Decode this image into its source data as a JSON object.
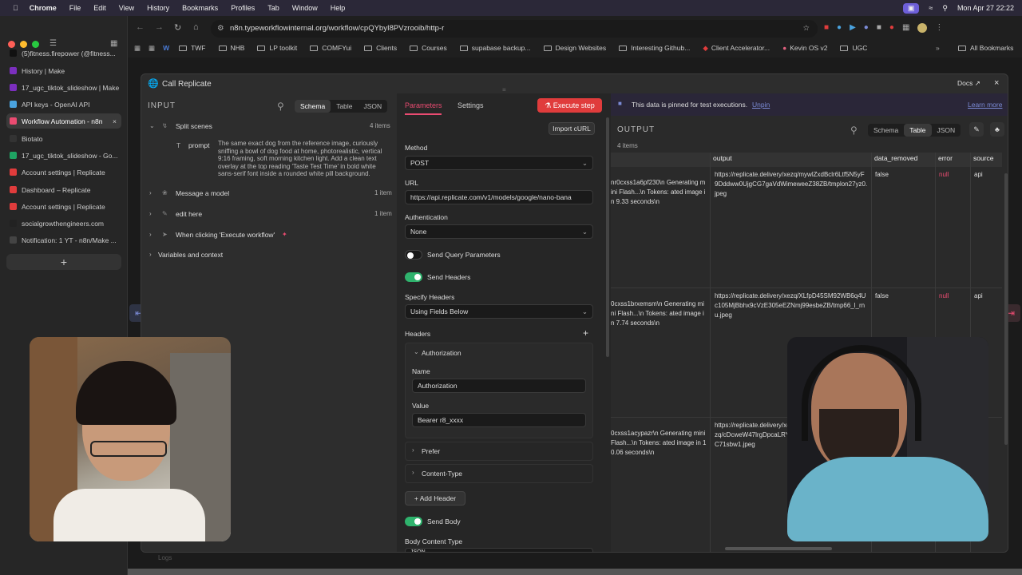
{
  "menubar": {
    "app": "Chrome",
    "items": [
      "File",
      "Edit",
      "View",
      "History",
      "Bookmarks",
      "Profiles",
      "Tab",
      "Window",
      "Help"
    ],
    "clock": "Mon Apr 27  22:22"
  },
  "sidebar": {
    "tabs": [
      {
        "label": "(5)fitness.firepower (@fitness...",
        "color": "#111"
      },
      {
        "label": "History | Make",
        "color": "#7b2fbe"
      },
      {
        "label": "17_ugc_tiktok_slideshow | Make",
        "color": "#7b2fbe"
      },
      {
        "label": "API keys - OpenAI API",
        "color": "#4aa3df"
      },
      {
        "label": "Workflow Automation - n8n",
        "color": "#ea4b71"
      },
      {
        "label": "Biotato",
        "color": "#333"
      },
      {
        "label": "17_ugc_tiktok_slideshow - Go...",
        "color": "#1fa463"
      },
      {
        "label": "Account settings | Replicate",
        "color": "#e03c3c"
      },
      {
        "label": "Dashboard – Replicate",
        "color": "#e03c3c"
      },
      {
        "label": "Account settings | Replicate",
        "color": "#e03c3c"
      },
      {
        "label": "socialgrowthengineers.com",
        "color": "#222"
      },
      {
        "label": "Notification: 1 YT - n8n/Make ...",
        "color": "#444"
      }
    ],
    "new_tab": "+"
  },
  "address": {
    "url": "n8n.typeworkflowinternal.org/workflow/cpQYbyI8PVzrooib/http-r"
  },
  "bookmarks": [
    "TWF",
    "NHB",
    "LP toolkit",
    "COMFYui",
    "Clients",
    "Courses",
    "supabase backup...",
    "Design Websites",
    "Interesting Github...",
    "Client Accelerator...",
    "Kevin OS v2",
    "UGC"
  ],
  "bookmarks_all": "All Bookmarks",
  "modal": {
    "title": "Call Replicate",
    "docs": "Docs",
    "close": "×"
  },
  "input": {
    "heading": "INPUT",
    "tabs": [
      "Schema",
      "Table",
      "JSON"
    ],
    "tree": [
      {
        "label": "Split scenes",
        "count": "4 items"
      },
      {
        "label": "Message a model",
        "count": "1 item"
      },
      {
        "label": "edit here",
        "count": "1 item"
      },
      {
        "label": "When clicking 'Execute workflow'",
        "count": ""
      },
      {
        "label": "Variables and context",
        "count": ""
      }
    ],
    "prompt_key": "prompt",
    "prompt_text": "The same exact dog from the reference image, curiously sniffing a bowl of dog food at home, photorealistic, vertical 9:16 framing, soft morning kitchen light. Add a clean text overlay at the top reading 'Taste Test Time' in bold white sans-serif font inside a rounded white pill background."
  },
  "params": {
    "tabs": [
      "Parameters",
      "Settings"
    ],
    "execute": "Execute step",
    "import_curl": "Import cURL",
    "method_label": "Method",
    "method": "POST",
    "url_label": "URL",
    "url": "https://api.replicate.com/v1/models/google/nano-bana",
    "auth_label": "Authentication",
    "auth": "None",
    "send_query": "Send Query Parameters",
    "send_headers": "Send Headers",
    "specify_headers_label": "Specify Headers",
    "specify_headers": "Using Fields Below",
    "headers_label": "Headers",
    "header_auth": "Authorization",
    "name_label": "Name",
    "name_value": "Authorization",
    "value_label": "Value",
    "value_value": "Bearer r8_xxxx",
    "prefer": "Prefer",
    "content_type": "Content-Type",
    "add_header": "Add Header",
    "send_body": "Send Body",
    "body_content_type": "Body Content Type",
    "body_type": "JSON"
  },
  "output": {
    "pinned": "This data is pinned for test executions.",
    "unpin": "Unpin",
    "learn_more": "Learn more",
    "heading": "OUTPUT",
    "count": "4 items",
    "tabs": [
      "Schema",
      "Table",
      "JSON"
    ],
    "columns": [
      "output",
      "data_removed",
      "error",
      "source"
    ],
    "rows": [
      {
        "logs": "nr0cxss1a6pf230\\n Generating mini Flash...\\n Tokens: ated image in 9.33 seconds\\n",
        "output": "https://replicate.delivery/xezq/mywlZxdBclr6Ltf5N5yF9Dddww0UjgCG7gaVdWimeweeZ38ZB/tmplon27yz0.jpeg",
        "removed": "false",
        "error": "null",
        "source": "api"
      },
      {
        "logs": "0cxss1brxemsm\\n Generating mini Flash...\\n Tokens: ated image in 7.74 seconds\\n",
        "output": "https://replicate.delivery/xezq/XLfpD45SM92WB6q4Uc105MjBbhx9cVzE305eEZNmj99esbeZB/tmp66_l_rnu.jpeg",
        "removed": "false",
        "error": "null",
        "source": "api"
      },
      {
        "logs": "0cxss1acypazr\\n Generating mini Flash...\\n Tokens: ated image in 10.06 seconds\\n",
        "output": "https://replicate.delivery/xezq/cDcweW47lrgDpcaLRYC71sbw1.jpeg",
        "removed": "",
        "error": "",
        "source": ""
      }
    ]
  },
  "footer": {
    "logs": "Logs"
  },
  "colors": {
    "accent": "#ea4b71",
    "green": "#2fb36d",
    "pinned": "#2a2638"
  }
}
